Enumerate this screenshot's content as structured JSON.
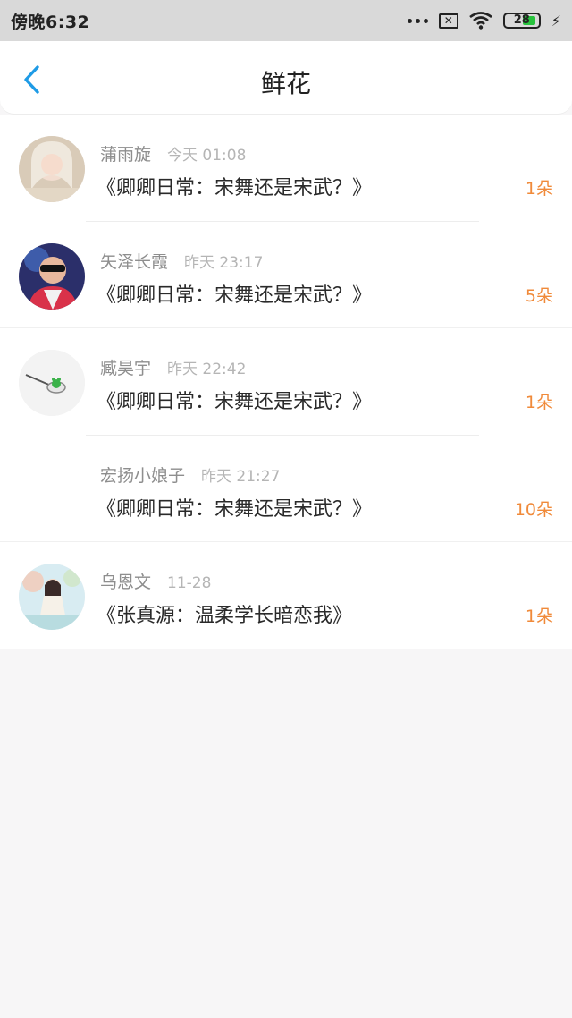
{
  "status_bar": {
    "time": "傍晚6:32",
    "battery": "28"
  },
  "nav": {
    "title": "鲜花"
  },
  "items": [
    {
      "name": "蒲雨旋",
      "time": "今天 01:08",
      "book": "《卿卿日常：宋舞还是宋武？》",
      "count": "1朵"
    },
    {
      "name": "矢泽长霞",
      "time": "昨天 23:17",
      "book": "《卿卿日常：宋舞还是宋武？》",
      "count": "5朵"
    },
    {
      "name": "臧昊宇",
      "time": "昨天 22:42",
      "book": "《卿卿日常：宋舞还是宋武？》",
      "count": "1朵"
    },
    {
      "name": "宏扬小娘子",
      "time": "昨天 21:27",
      "book": "《卿卿日常：宋舞还是宋武？》",
      "count": "10朵"
    },
    {
      "name": "乌恩文",
      "time": "11-28",
      "book": "《张真源：温柔学长暗恋我》",
      "count": "1朵"
    }
  ],
  "colors": {
    "accent": "#1e9be6",
    "count": "#f08a3a"
  }
}
